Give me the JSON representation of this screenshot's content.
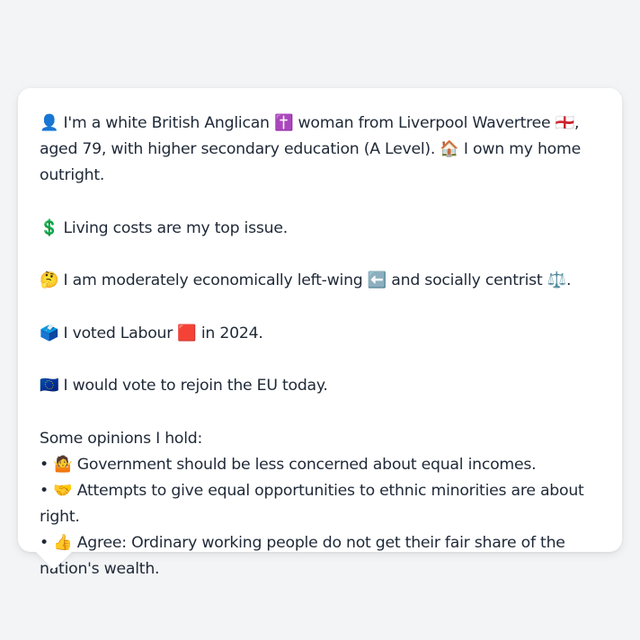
{
  "profile": {
    "icon_person": "👤",
    "intro_a": " I'm a white British Anglican ",
    "icon_cross": "✝️",
    "intro_b": " woman from Liverpool Wavertree ",
    "icon_flag": "🏴󠁧󠁢󠁥󠁮󠁧󠁿",
    "intro_c": ", aged 79, with higher secondary education (A Level). ",
    "icon_house": "🏠",
    "intro_d": " I own my home outright."
  },
  "issue": {
    "icon": "💲",
    "text": " Living costs are my top issue."
  },
  "ideology": {
    "icon_think": "🤔",
    "text_a": " I am moderately economically left-wing ",
    "icon_left": "⬅️",
    "text_b": " and socially centrist ",
    "icon_scales": "⚖️",
    "text_c": "."
  },
  "vote": {
    "icon_ballot": "🗳️",
    "text_a": " I voted Labour ",
    "icon_party": "🟥",
    "text_b": " in 2024."
  },
  "eu": {
    "icon": "🇪🇺",
    "text": " I would vote to rejoin the EU today."
  },
  "opinions": {
    "heading": "Some opinions I hold:",
    "bullet": "•",
    "items": [
      {
        "icon": "🤷",
        "text": " Government should be less concerned about equal incomes."
      },
      {
        "icon": "🤝",
        "text": " Attempts to give equal opportunities to ethnic minorities are about right."
      },
      {
        "icon": "👍",
        "text": " Agree: Ordinary working people do not get their fair share of the nation's wealth."
      }
    ]
  }
}
